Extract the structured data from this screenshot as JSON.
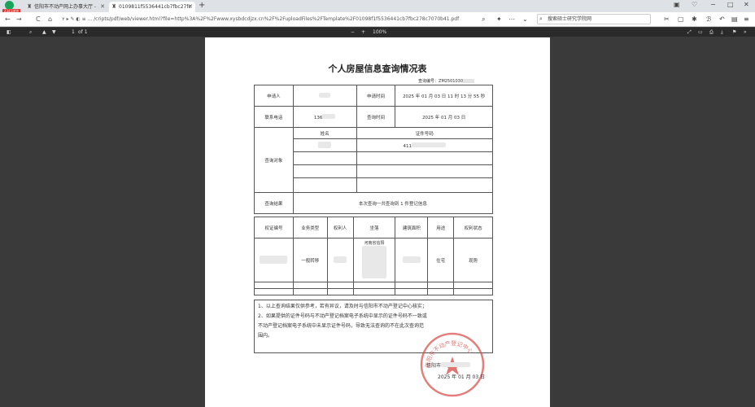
{
  "browser": {
    "badge": "2345浏览器",
    "tabs": [
      {
        "title": "信阳市不动产网上办事大厅 -",
        "close": "✕"
      },
      {
        "title": "0109811f5536441cb7fbc27fc",
        "close": "✕"
      }
    ],
    "new_tab": "+",
    "window": {
      "min": "−",
      "max": "□",
      "close": "✕"
    },
    "url": "ʏ ▸ ✎ ◐ ≡ ... /cripts/pdf/web/viewer.html?file=http%3A%2F%2Fwww.xysbdcdjzx.cn%2F%2FuploadFiles%2FTemplate%2F01098f1f5536441cb7fbc278c7070b41.pdf",
    "search_placeholder": "搜索硕士研究学院网",
    "nav": {
      "back": "←",
      "forward": "→",
      "reload": "C",
      "home": "⌂"
    }
  },
  "pdf_toolbar": {
    "page_label": "1",
    "page_of": "of 1",
    "zoom": "100%",
    "zoom_out": "−",
    "zoom_in": "+"
  },
  "document": {
    "title": "个人房屋信息查询情况表",
    "query_no_label": "查询编号：",
    "query_no": "ZM2501030",
    "applicant_label": "申请人",
    "apply_time_label": "申请时间",
    "apply_time": "2025 年 01 月 03 日  11 时 13 分 55 秒",
    "phone_label": "联系电话",
    "phone": "136",
    "query_time_label": "查询时间",
    "query_time": "2025 年 01 月 03 日",
    "target_label": "查询对象",
    "name_header": "姓名",
    "id_header": "证件号码",
    "id_value": "411",
    "result_label": "查询结果",
    "result_text": "本次查询一共查询到 1 件登记信息",
    "cols": [
      "权证编号",
      "业务类型",
      "权利人",
      "坐落",
      "建筑面积",
      "用途",
      "权利状态"
    ],
    "row": {
      "business_type": "一般转移",
      "location_head": "河南省信阳",
      "usage": "住宅",
      "status": "现势"
    },
    "notes": [
      "1、以上查询结果仅供参考，若有异议，请及时与信阳市不动产登记中心核实；",
      "2、如果提供的证件号码与不动产登记档案电子系统中显示的证件号码不一致或",
      "不动产登记档案电子系统中未显示证件号码，导致无法查询的不在此次查询范",
      "围内。"
    ],
    "sign_org": "信阳市",
    "sign_date": "2025 年 01 月 03 日",
    "stamp_text": "信阳市不动产登记中心"
  }
}
